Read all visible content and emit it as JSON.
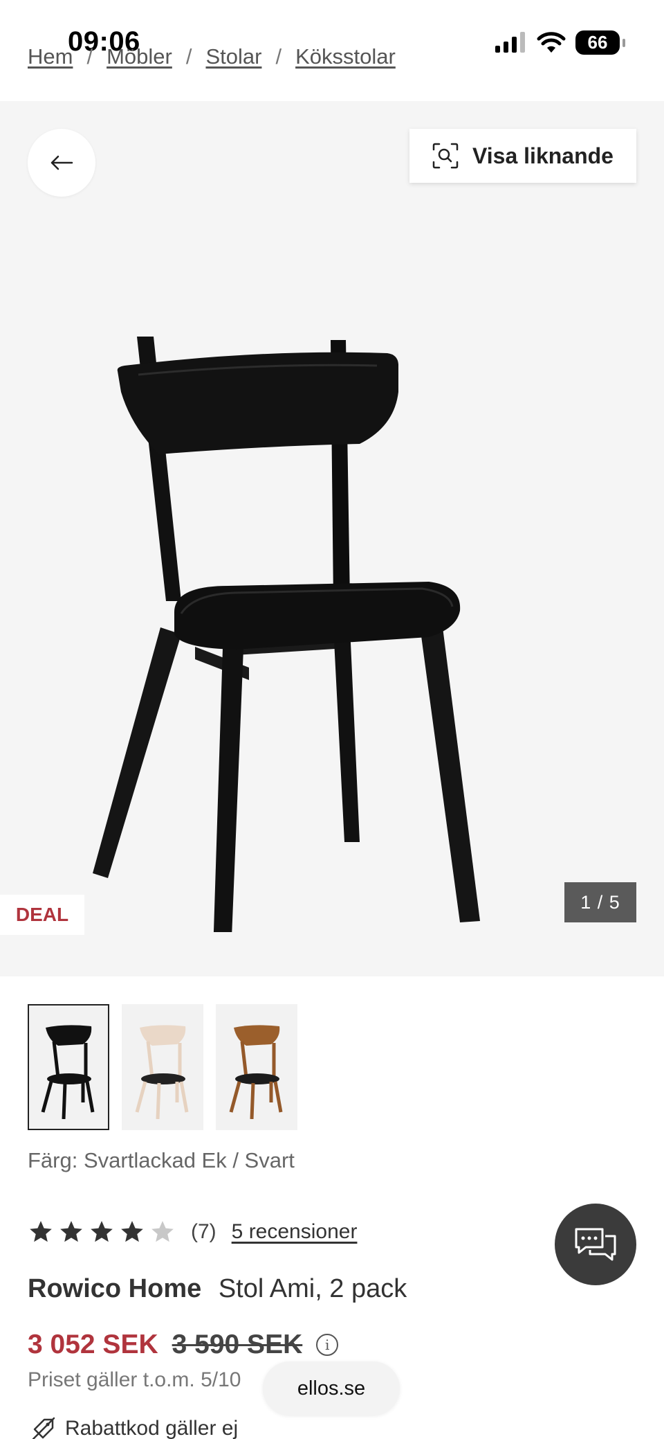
{
  "status_bar": {
    "time": "09:06",
    "battery": "66"
  },
  "breadcrumb": [
    {
      "label": "Hem"
    },
    {
      "label": "Möbler"
    },
    {
      "label": "Stolar"
    },
    {
      "label": "Köksstolar"
    }
  ],
  "gallery": {
    "similar_label": "Visa liknande",
    "deal_label": "DEAL",
    "current": "1",
    "total": "5",
    "counter_text": "1 / 5"
  },
  "product": {
    "color_label": "Färg: Svartlackad Ek / Svart",
    "rating": 4,
    "rating_max": 5,
    "rating_count_text": "(7)",
    "reviews_link": "5 recensioner",
    "brand": "Rowico Home",
    "name": "Stol Ami, 2 pack",
    "price_now": "3 052 SEK",
    "price_old": "3 590 SEK",
    "price_valid": "Priset gäller t.o.m. 5/10",
    "discount_note": "Rabattkod gäller ej"
  },
  "footer": {
    "site": "ellos.se"
  },
  "colors": {
    "sale_red": "#b0343d",
    "dark": "#333333"
  }
}
